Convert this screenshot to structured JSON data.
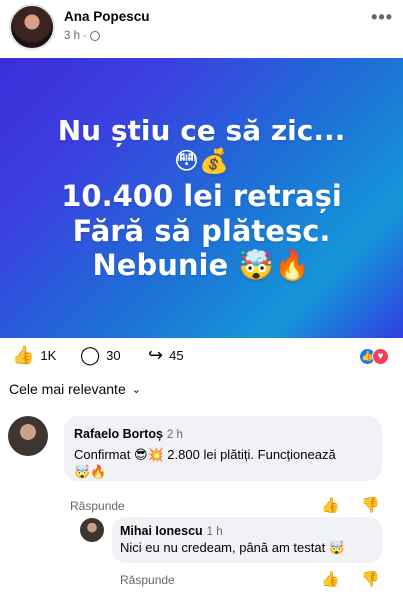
{
  "post": {
    "author": "Ana Popescu",
    "time": "3 h",
    "separator": "·",
    "more": "•••",
    "image_lines": [
      "Nu știu ce să zic...",
      "😳💰",
      "10.400 lei retrași",
      "Fără să plătesc.",
      "Nebunie 🤯🔥"
    ]
  },
  "actions": {
    "likes": "1K",
    "comments": "30",
    "shares": "45",
    "like_glyph": "👍",
    "comment_glyph": "◯",
    "share_glyph": "↪",
    "reaction_like": "👍",
    "reaction_love": "♥"
  },
  "sort": {
    "label": "Cele mai relevante",
    "chevron": "⌄"
  },
  "comments": [
    {
      "name": "Rafaelo Bortoș",
      "time": "2 h",
      "text_line1": "Confirmat 😎💥 2.800 lei plătiți. Funcționează",
      "text_line2": "🤯🔥",
      "reply": "Răspunde"
    },
    {
      "name": "Mihai Ionescu",
      "time": "1 h",
      "text": "Nici eu nu credeam, până am testat 🤯",
      "reply": "Răspunde"
    }
  ],
  "vote_icons": {
    "up": "👍",
    "down": "👎"
  }
}
